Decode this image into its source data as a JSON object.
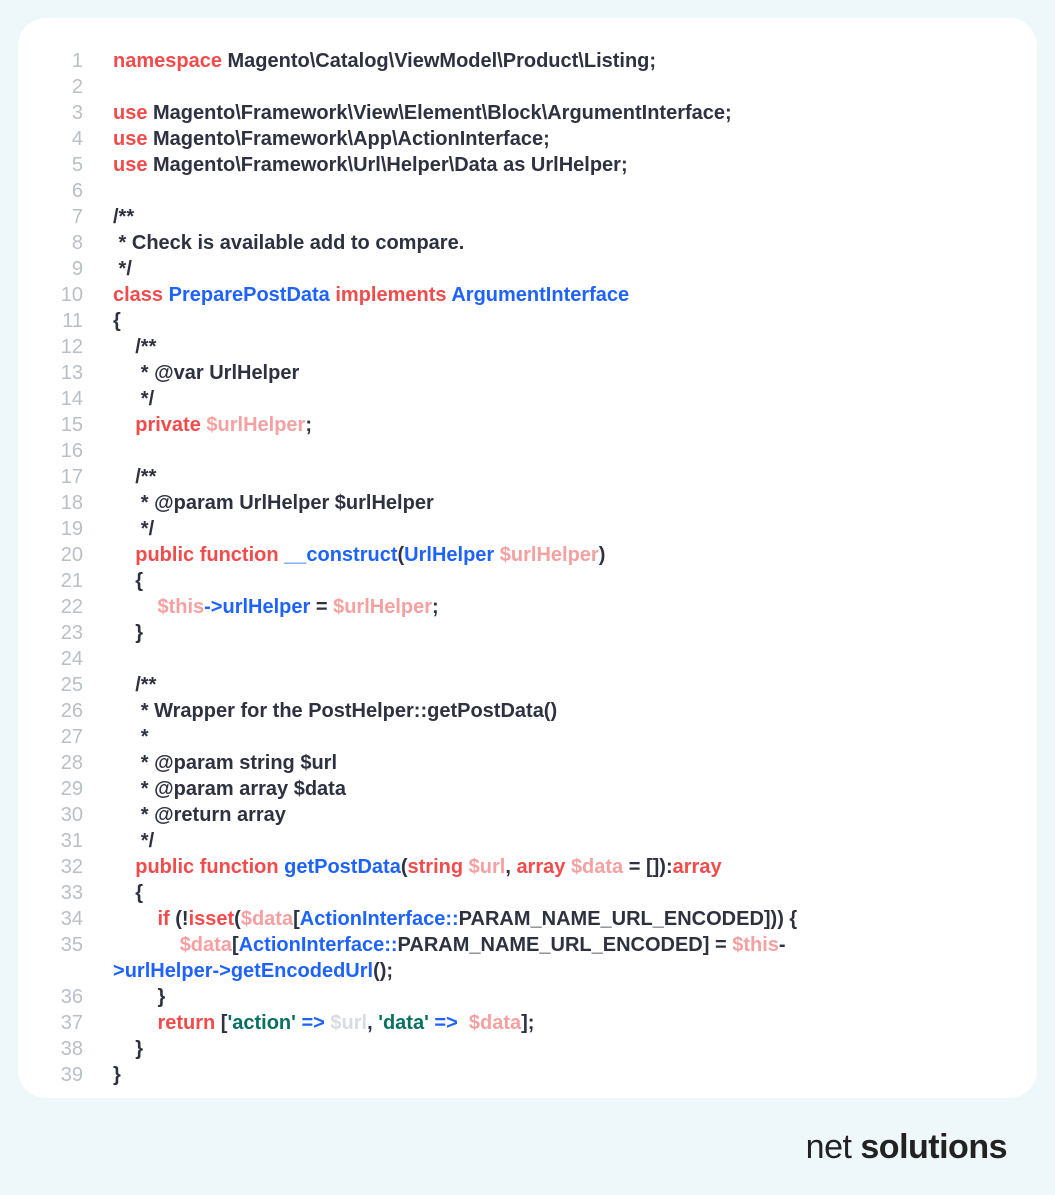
{
  "logo": {
    "part1": "net ",
    "part2": "solutions"
  },
  "code": {
    "lines": [
      {
        "n": "1",
        "tokens": [
          {
            "c": "kw",
            "t": "namespace"
          },
          {
            "t": " Magento\\Catalog\\ViewModel\\Product\\Listing;"
          }
        ]
      },
      {
        "n": "2",
        "tokens": []
      },
      {
        "n": "3",
        "tokens": [
          {
            "c": "kw",
            "t": "use"
          },
          {
            "t": " Magento\\Framework\\View\\Element\\Block\\ArgumentInterface;"
          }
        ]
      },
      {
        "n": "4",
        "tokens": [
          {
            "c": "kw",
            "t": "use"
          },
          {
            "t": " Magento\\Framework\\App\\ActionInterface;"
          }
        ]
      },
      {
        "n": "5",
        "tokens": [
          {
            "c": "kw",
            "t": "use"
          },
          {
            "t": " Magento\\Framework\\Url\\Helper\\Data as UrlHelper;"
          }
        ]
      },
      {
        "n": "6",
        "tokens": []
      },
      {
        "n": "7",
        "tokens": [
          {
            "t": "/**"
          }
        ]
      },
      {
        "n": "8",
        "tokens": [
          {
            "t": " * Check is available add to compare."
          }
        ]
      },
      {
        "n": "9",
        "tokens": [
          {
            "t": " */"
          }
        ]
      },
      {
        "n": "10",
        "tokens": [
          {
            "c": "kw",
            "t": "class"
          },
          {
            "t": " "
          },
          {
            "c": "cls",
            "t": "PreparePostData"
          },
          {
            "t": " "
          },
          {
            "c": "kw",
            "t": "implements"
          },
          {
            "t": " "
          },
          {
            "c": "cls",
            "t": "ArgumentInterface"
          }
        ]
      },
      {
        "n": "11",
        "tokens": [
          {
            "t": "{"
          }
        ]
      },
      {
        "n": "12",
        "tokens": [
          {
            "t": "    /**"
          }
        ]
      },
      {
        "n": "13",
        "tokens": [
          {
            "t": "     * @var UrlHelper"
          }
        ]
      },
      {
        "n": "14",
        "tokens": [
          {
            "t": "     */"
          }
        ]
      },
      {
        "n": "15",
        "tokens": [
          {
            "t": "    "
          },
          {
            "c": "kw",
            "t": "private"
          },
          {
            "t": " "
          },
          {
            "c": "var",
            "t": "$urlHelper"
          },
          {
            "t": ";"
          }
        ]
      },
      {
        "n": "16",
        "tokens": []
      },
      {
        "n": "17",
        "tokens": [
          {
            "t": "    /**"
          }
        ]
      },
      {
        "n": "18",
        "tokens": [
          {
            "t": "     * @param UrlHelper $urlHelper"
          }
        ]
      },
      {
        "n": "19",
        "tokens": [
          {
            "t": "     */"
          }
        ]
      },
      {
        "n": "20",
        "tokens": [
          {
            "t": "    "
          },
          {
            "c": "kw",
            "t": "public"
          },
          {
            "t": " "
          },
          {
            "c": "kw",
            "t": "function"
          },
          {
            "t": " "
          },
          {
            "c": "cls",
            "t": "__construct"
          },
          {
            "t": "("
          },
          {
            "c": "cls",
            "t": "UrlHelper"
          },
          {
            "t": " "
          },
          {
            "c": "var",
            "t": "$urlHelper"
          },
          {
            "t": ")"
          }
        ]
      },
      {
        "n": "21",
        "tokens": [
          {
            "t": "    {"
          }
        ]
      },
      {
        "n": "22",
        "tokens": [
          {
            "t": "        "
          },
          {
            "c": "var",
            "t": "$this"
          },
          {
            "c": "op",
            "t": "->"
          },
          {
            "c": "cls",
            "t": "urlHelper"
          },
          {
            "t": " = "
          },
          {
            "c": "var",
            "t": "$urlHelper"
          },
          {
            "t": ";"
          }
        ]
      },
      {
        "n": "23",
        "tokens": [
          {
            "t": "    }"
          }
        ]
      },
      {
        "n": "24",
        "tokens": []
      },
      {
        "n": "25",
        "tokens": [
          {
            "t": "    /**"
          }
        ]
      },
      {
        "n": "26",
        "tokens": [
          {
            "t": "     * Wrapper for the PostHelper::getPostData()"
          }
        ]
      },
      {
        "n": "27",
        "tokens": [
          {
            "t": "     *"
          }
        ]
      },
      {
        "n": "28",
        "tokens": [
          {
            "t": "     * @param string $url"
          }
        ]
      },
      {
        "n": "29",
        "tokens": [
          {
            "t": "     * @param array $data"
          }
        ]
      },
      {
        "n": "30",
        "tokens": [
          {
            "t": "     * @return array"
          }
        ]
      },
      {
        "n": "31",
        "tokens": [
          {
            "t": "     */"
          }
        ]
      },
      {
        "n": "32",
        "tokens": [
          {
            "t": "    "
          },
          {
            "c": "kw",
            "t": "public"
          },
          {
            "t": " "
          },
          {
            "c": "kw",
            "t": "function"
          },
          {
            "t": " "
          },
          {
            "c": "cls",
            "t": "getPostData"
          },
          {
            "t": "("
          },
          {
            "c": "kw",
            "t": "string"
          },
          {
            "t": " "
          },
          {
            "c": "var",
            "t": "$url"
          },
          {
            "t": ", "
          },
          {
            "c": "kw",
            "t": "array"
          },
          {
            "t": " "
          },
          {
            "c": "var",
            "t": "$data"
          },
          {
            "t": " = []):"
          },
          {
            "c": "kw",
            "t": "array"
          }
        ]
      },
      {
        "n": "33",
        "tokens": [
          {
            "t": "    {"
          }
        ]
      },
      {
        "n": "34",
        "tokens": [
          {
            "t": "        "
          },
          {
            "c": "kw",
            "t": "if"
          },
          {
            "t": " (!"
          },
          {
            "c": "kw",
            "t": "isset"
          },
          {
            "t": "("
          },
          {
            "c": "var",
            "t": "$data"
          },
          {
            "t": "["
          },
          {
            "c": "cls",
            "t": "ActionInterface"
          },
          {
            "c": "op",
            "t": "::"
          },
          {
            "t": "PARAM_NAME_URL_ENCODED])) {"
          }
        ]
      },
      {
        "n": "35",
        "tokens": [
          {
            "t": "            "
          },
          {
            "c": "var",
            "t": "$data"
          },
          {
            "t": "["
          },
          {
            "c": "cls",
            "t": "ActionInterface"
          },
          {
            "c": "op",
            "t": "::"
          },
          {
            "t": "PARAM_NAME_URL_ENCODED] = "
          },
          {
            "c": "var",
            "t": "$this"
          },
          {
            "t": "-"
          }
        ]
      },
      {
        "n": "",
        "tokens": [
          {
            "c": "op",
            "t": ">"
          },
          {
            "c": "cls",
            "t": "urlHelper"
          },
          {
            "c": "op",
            "t": "->"
          },
          {
            "c": "cls",
            "t": "getEncodedUrl"
          },
          {
            "t": "();"
          }
        ]
      },
      {
        "n": "36",
        "tokens": [
          {
            "t": "        }"
          }
        ]
      },
      {
        "n": "37",
        "tokens": [
          {
            "t": "        "
          },
          {
            "c": "kw",
            "t": "return"
          },
          {
            "t": " ["
          },
          {
            "c": "str",
            "t": "'action'"
          },
          {
            "t": " "
          },
          {
            "c": "op",
            "t": "=>"
          },
          {
            "t": " "
          },
          {
            "c": "lt",
            "t": "$url"
          },
          {
            "t": ", "
          },
          {
            "c": "str",
            "t": "'data'"
          },
          {
            "t": " "
          },
          {
            "c": "op",
            "t": "=>"
          },
          {
            "t": "  "
          },
          {
            "c": "var",
            "t": "$data"
          },
          {
            "t": "];"
          }
        ]
      },
      {
        "n": "38",
        "tokens": [
          {
            "t": "    }"
          }
        ]
      },
      {
        "n": "39",
        "tokens": [
          {
            "t": "}"
          }
        ]
      }
    ]
  }
}
